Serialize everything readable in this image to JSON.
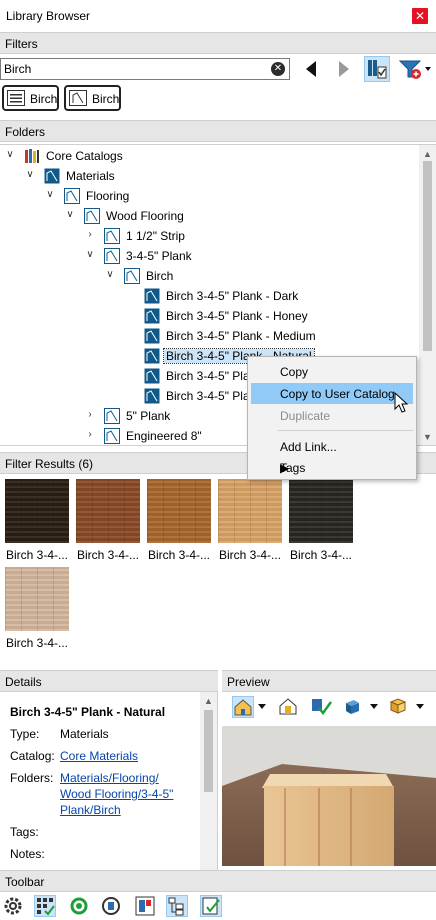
{
  "window": {
    "title": "Library Browser",
    "close_glyph": "✕"
  },
  "filters": {
    "header": "Filters",
    "search": {
      "value": "Birch",
      "placeholder": ""
    },
    "chips": [
      {
        "label": "Birch",
        "icon": "list-icon"
      },
      {
        "label": "Birch",
        "icon": "material-icon"
      }
    ]
  },
  "folders": {
    "header": "Folders",
    "tree": [
      {
        "label": "Core Catalogs",
        "depth": 0,
        "expanded": true,
        "icon": "catalog-icon"
      },
      {
        "label": "Materials",
        "depth": 1,
        "expanded": true,
        "icon": "material-folder-icon"
      },
      {
        "label": "Flooring",
        "depth": 2,
        "expanded": true,
        "icon": "material-folder-icon"
      },
      {
        "label": "Wood Flooring",
        "depth": 3,
        "expanded": true,
        "icon": "material-folder-icon"
      },
      {
        "label": "1 1/2\" Strip",
        "depth": 4,
        "expanded": false,
        "icon": "material-folder-icon"
      },
      {
        "label": "3-4-5\" Plank",
        "depth": 4,
        "expanded": true,
        "icon": "material-folder-icon"
      },
      {
        "label": "Birch",
        "depth": 5,
        "expanded": true,
        "icon": "material-folder-icon"
      },
      {
        "label": "Birch 3-4-5\" Plank - Dark",
        "depth": 6,
        "icon": "material-item-icon"
      },
      {
        "label": "Birch 3-4-5\" Plank - Honey",
        "depth": 6,
        "icon": "material-item-icon"
      },
      {
        "label": "Birch 3-4-5\" Plank - Medium",
        "depth": 6,
        "icon": "material-item-icon"
      },
      {
        "label": "Birch 3-4-5\" Plank - Natural",
        "depth": 6,
        "icon": "material-item-icon",
        "selected": true
      },
      {
        "label": "Birch 3-4-5\" Pla",
        "depth": 6,
        "icon": "material-item-icon"
      },
      {
        "label": "Birch 3-4-5\" Pla",
        "depth": 6,
        "icon": "material-item-icon"
      },
      {
        "label": "5\" Plank",
        "depth": 4,
        "expanded": false,
        "icon": "material-folder-icon"
      },
      {
        "label": "Engineered 8\"",
        "depth": 4,
        "expanded": false,
        "icon": "material-folder-icon"
      }
    ]
  },
  "context_menu": {
    "items": [
      {
        "label": "Copy",
        "state": "normal"
      },
      {
        "label": "Copy to User Catalog",
        "state": "highlighted"
      },
      {
        "label": "Duplicate",
        "state": "disabled"
      },
      {
        "label": "Add Link...",
        "state": "normal"
      },
      {
        "label": "Tags",
        "state": "normal",
        "submenu": true
      }
    ]
  },
  "filter_results": {
    "header": "Filter Results (6)",
    "items": [
      {
        "label": "Birch 3-4-...",
        "color": "#2a1f14"
      },
      {
        "label": "Birch 3-4-...",
        "color": "#8a4a26"
      },
      {
        "label": "Birch 3-4-...",
        "color": "#a8672e"
      },
      {
        "label": "Birch 3-4-...",
        "color": "#d9a367"
      },
      {
        "label": "Birch 3-4-...",
        "color": "#2b2723"
      },
      {
        "label": "Birch 3-4-...",
        "color": "#d3b79c"
      }
    ]
  },
  "details": {
    "header": "Details",
    "name": "Birch 3-4-5\" Plank - Natural",
    "type_label": "Type:",
    "type_value": "Materials",
    "catalog_label": "Catalog:",
    "catalog_value": "Core Materials",
    "folders_label": "Folders:",
    "folders_line1": "Materials/Flooring/",
    "folders_line2": "Wood Flooring/3-4-5\"",
    "folders_line3": "Plank/Birch",
    "tags_label": "Tags:",
    "notes_label": "Notes:"
  },
  "preview": {
    "header": "Preview"
  },
  "toolbar": {
    "header": "Toolbar"
  },
  "colors": {
    "accent": "#0f5a8a",
    "selection": "#cce4f7",
    "menu_highlight": "#91c9f7",
    "link": "#0645ad"
  }
}
